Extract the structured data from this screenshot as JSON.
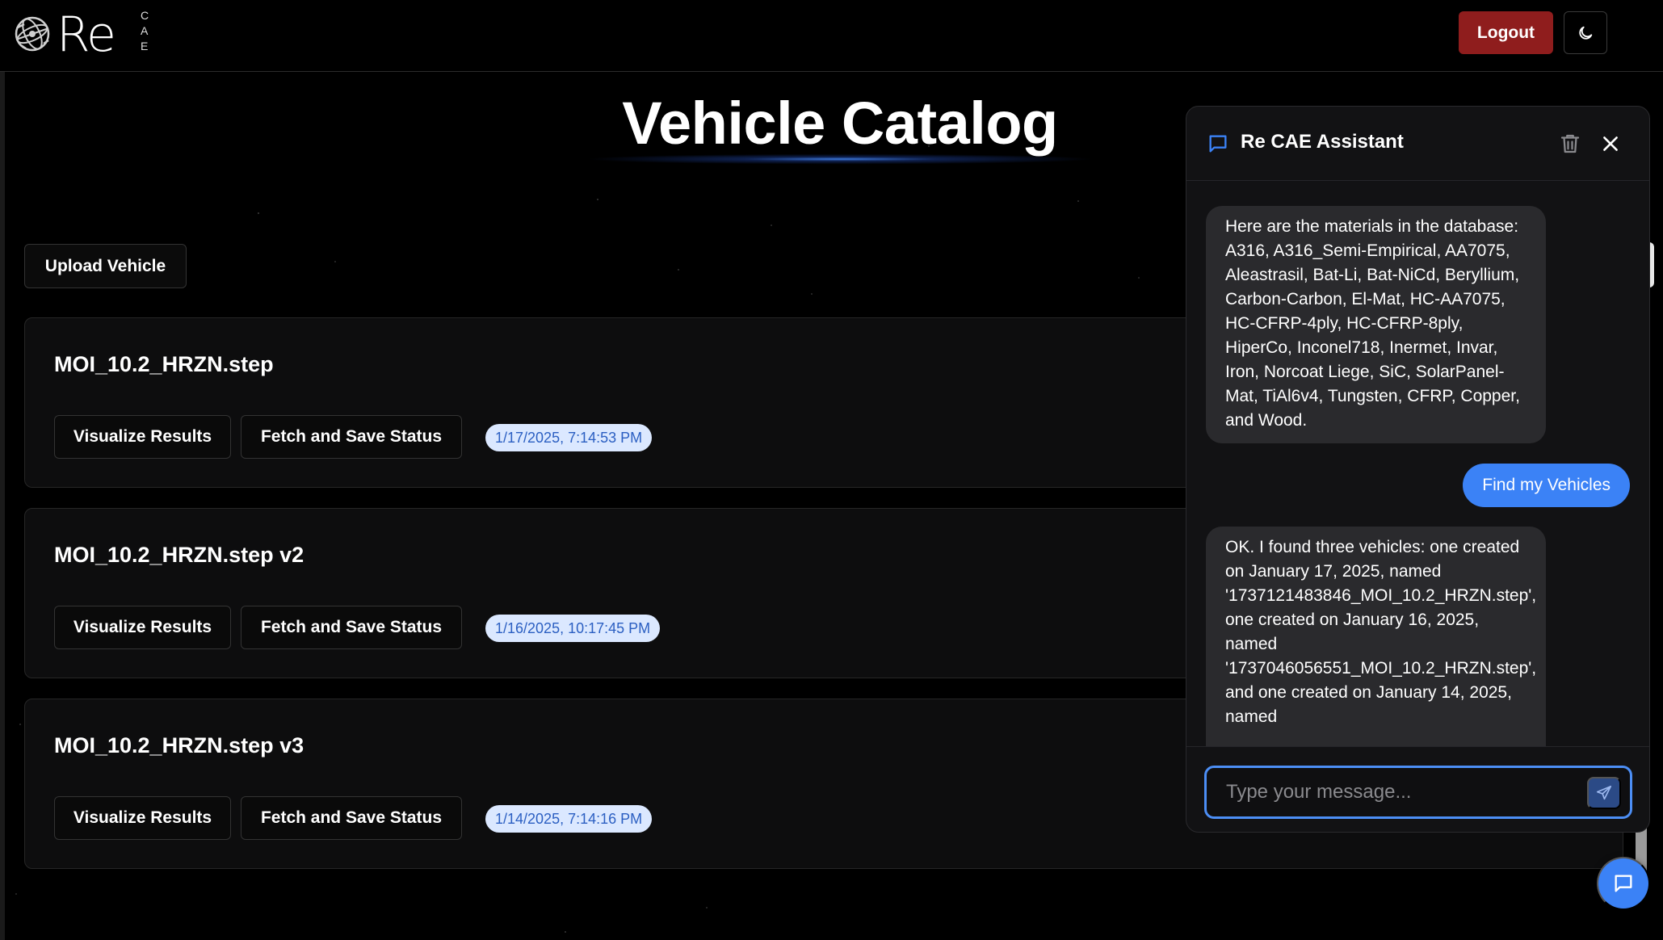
{
  "header": {
    "logo_text": "Re",
    "logo_sub": [
      "C",
      "A",
      "E"
    ],
    "logout_label": "Logout",
    "theme_icon": "moon-icon"
  },
  "page": {
    "title": "Vehicle Catalog",
    "upload_label": "Upload Vehicle"
  },
  "vehicles": [
    {
      "name": "MOI_10.2_HRZN.step",
      "visualize_label": "Visualize Results",
      "fetch_label": "Fetch and Save Status",
      "timestamp": "1/17/2025, 7:14:53 PM"
    },
    {
      "name": "MOI_10.2_HRZN.step v2",
      "visualize_label": "Visualize Results",
      "fetch_label": "Fetch and Save Status",
      "timestamp": "1/16/2025, 10:17:45 PM"
    },
    {
      "name": "MOI_10.2_HRZN.step v3",
      "visualize_label": "Visualize Results",
      "fetch_label": "Fetch and Save Status",
      "timestamp": "1/14/2025, 7:14:16 PM"
    }
  ],
  "chat": {
    "title": "Re CAE Assistant",
    "messages": [
      {
        "role": "assistant",
        "text": "Here are the materials in the database: A316, A316_Semi-Empirical, AA7075, Aleastrasil, Bat-Li, Bat-NiCd, Beryllium, Carbon-Carbon, El-Mat, HC-AA7075, HC-CFRP-4ply, HC-CFRP-8ply, HiperCo, Inconel718, Inermet, Invar, Iron, Norcoat Liege, SiC, SolarPanel-Mat, TiAl6v4, Tungsten, CFRP, Copper, and Wood."
      },
      {
        "role": "user",
        "text": "Find my Vehicles"
      },
      {
        "role": "assistant",
        "text": "OK. I found three vehicles: one created on January 17, 2025, named '1737121483846_MOI_10.2_HRZN.step', one created on January 16, 2025, named '1737046056551_MOI_10.2_HRZN.step', and one created on January 14, 2025, named"
      }
    ],
    "input_placeholder": "Type your message...",
    "input_value": ""
  },
  "colors": {
    "accent": "#3b82f6",
    "logout": "#8f1d1d",
    "badge_bg": "#dbe8ff",
    "badge_text": "#2b5fc2"
  }
}
